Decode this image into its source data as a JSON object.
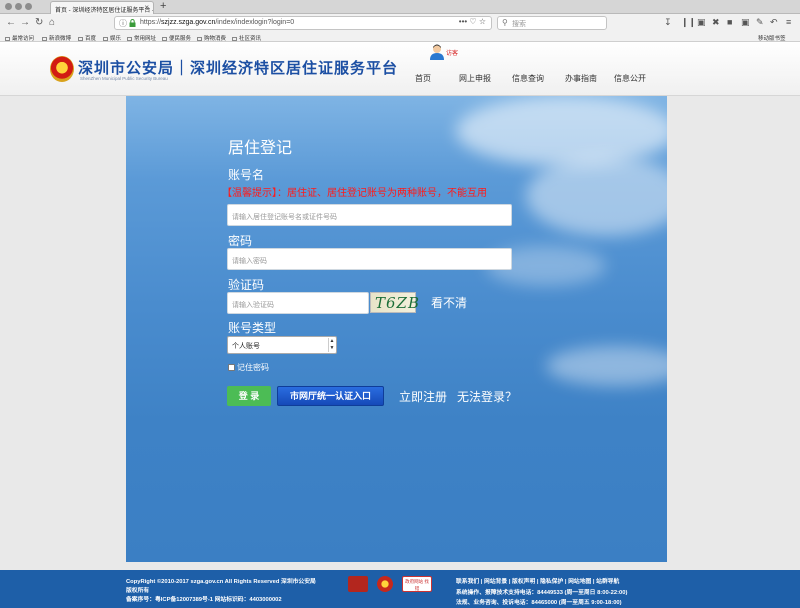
{
  "browser": {
    "tab_title": "首页 - 深圳经济特区居住证服务平台 -",
    "tab_close": "×",
    "tab_new": "+",
    "url_host": "szjzz.szga.gov.cn",
    "url_path": "/index/indexlogin?login=0",
    "url_prefix": "https://",
    "url_actions": "•••  ♡  ☆",
    "search_placeholder": "搜索",
    "bookmarks": [
      "最常访问",
      "新浪微博",
      "百度",
      "娱乐",
      "常用网址",
      "便民服务",
      "购物消费",
      "社区资讯"
    ],
    "mobile_bookmarks": "移动版书签"
  },
  "header": {
    "logo_title": "深圳市公安局｜深圳经济特区居住证服务平台",
    "logo_subtitle": "ShenZhen Municipal Public Security Bureau",
    "user_label": "访客",
    "menu": [
      "首页",
      "网上申报",
      "信息查询",
      "办事指南",
      "信息公开"
    ]
  },
  "form": {
    "title": "居住登记",
    "account_label": "账号名",
    "warning": "【温馨提示】：居住证、居住登记账号为两种账号，不能互用",
    "account_placeholder": "请输入居住登记账号名或证件号码",
    "password_label": "密码",
    "password_placeholder": "请输入密码",
    "captcha_label": "验证码",
    "captcha_placeholder": "请输入验证码",
    "captcha_text": "T6ZB",
    "refresh_label": "看不清",
    "account_type_label": "账号类型",
    "account_type_value": "个人账号",
    "remember_label": "记住密码",
    "login_button": "登 录",
    "portal_button": "市网厅统一认证入口",
    "register_link": "立即注册",
    "cannot_login_link": "无法登录？"
  },
  "footer": {
    "copyright": "CopyRight ©2010-2017 szga.gov.cn All Rights Reserved 深圳市公安局",
    "rights": "版权所有",
    "icp": "备案序号：粤ICP备12007389号-1 网站标识码：4403000002",
    "links": "联系我们 | 网站背景 | 版权声明 | 隐私保护 | 网站地图 | 站群导航",
    "support1": "系统操作、报障技术支持电话：84449533 (周一至周日 8:00-22:00)",
    "support2": "法规、业务咨询、投诉电话：84465000 (周一至周五 9:00-18:00)",
    "badge_gov": "政府网站 找错"
  }
}
